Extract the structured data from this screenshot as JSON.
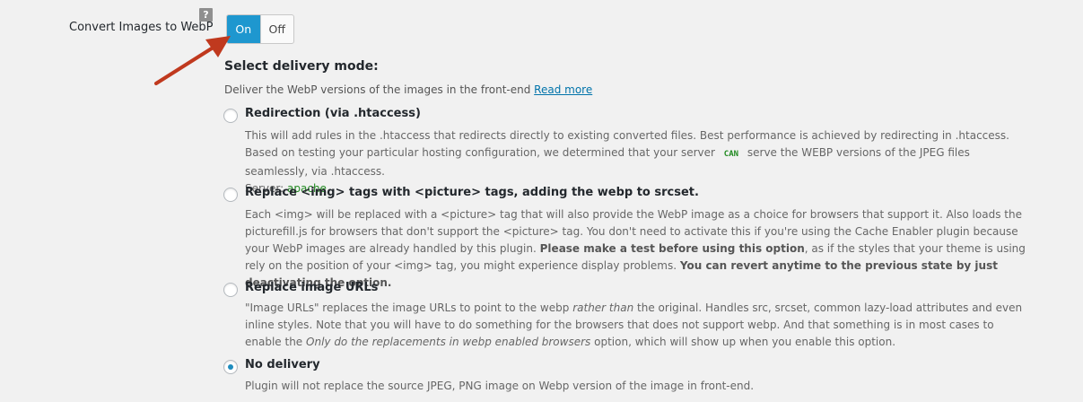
{
  "setting": {
    "label": "Convert Images to WebP",
    "help": "?",
    "toggle_on": "On",
    "toggle_off": "Off"
  },
  "delivery": {
    "title": "Select delivery mode:",
    "description": "Deliver the WebP versions of the images in the front-end",
    "read_more": "Read more",
    "options": [
      {
        "label": "Redirection (via .htaccess)",
        "desc1": "This will add rules in the .htaccess that redirects directly to existing converted files. Best performance is achieved by redirecting in .htaccess. Based on testing your particular hosting configuration, we determined that your server",
        "can": "CAN",
        "desc2": "serve the WEBP versions of the JPEG files seamlessly, via .htaccess.",
        "server_label": "Server:",
        "server_value": "apache"
      },
      {
        "label": "Replace <img> tags with <picture> tags, adding the webp to srcset.",
        "desc1": "Each <img> will be replaced with a <picture> tag that will also provide the WebP image as a choice for browsers that support it. Also loads the picturefill.js for browsers that don't support the <picture> tag. You don't need to activate this if you're using the Cache Enabler plugin because your WebP images are already handled by this plugin.",
        "bold1": "Please make a test before using this option",
        "desc2": ", as if the styles that your theme is using rely on the position of your <img> tag, you might experience display problems.",
        "bold2": "You can revert anytime to the previous state by just deactivating the option."
      },
      {
        "label": "Replace image URLs",
        "desc1": "\"Image URLs\" replaces the image URLs to point to the webp",
        "em1": "rather than",
        "desc2": "the original. Handles src, srcset, common lazy-load attributes and even inline styles. Note that you will have to do something for the browsers that does not support webp. And that something is in most cases to enable the",
        "em2": "Only do the replacements in webp enabled browsers",
        "desc3": "option, which will show up when you enable this option."
      },
      {
        "label": "No delivery",
        "desc1": "Plugin will not replace the source JPEG, PNG image on Webp version of the image in front-end.",
        "checked": true
      }
    ]
  },
  "colors": {
    "accent": "#1e97cf",
    "arrow": "#c0391e",
    "success": "#218a21",
    "link": "#0073aa"
  }
}
